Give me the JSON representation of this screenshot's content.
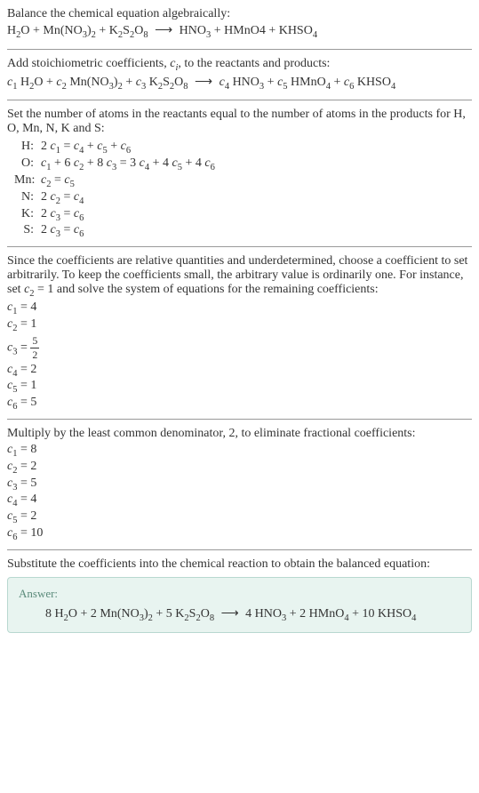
{
  "intro": {
    "line1": "Balance the chemical equation algebraically:",
    "eq": "H₂O + Mn(NO₃)₂ + K₂S₂O₈  ⟶  HNO₃ + HMnO4 + KHSO₄"
  },
  "stoich": {
    "line1": "Add stoichiometric coefficients, cᵢ, to the reactants and products:",
    "eq": "c₁ H₂O + c₂ Mn(NO₃)₂ + c₃ K₂S₂O₈  ⟶  c₄ HNO₃ + c₅ HMnO₄ + c₆ KHSO₄"
  },
  "atoms": {
    "intro": "Set the number of atoms in the reactants equal to the number of atoms in the products for H, O, Mn, N, K and S:",
    "rows": [
      {
        "el": "H:",
        "eq": "2 c₁ = c₄ + c₅ + c₆"
      },
      {
        "el": "O:",
        "eq": "c₁ + 6 c₂ + 8 c₃ = 3 c₄ + 4 c₅ + 4 c₆"
      },
      {
        "el": "Mn:",
        "eq": "c₂ = c₅"
      },
      {
        "el": "N:",
        "eq": "2 c₂ = c₄"
      },
      {
        "el": "K:",
        "eq": "2 c₃ = c₆"
      },
      {
        "el": "S:",
        "eq": "2 c₃ = c₆"
      }
    ]
  },
  "solve1": {
    "intro": "Since the coefficients are relative quantities and underdetermined, choose a coefficient to set arbitrarily. To keep the coefficients small, the arbitrary value is ordinarily one. For instance, set c₂ = 1 and solve the system of equations for the remaining coefficients:",
    "rows": [
      {
        "lhs": "c₁",
        "rhs": "4",
        "frac": false
      },
      {
        "lhs": "c₂",
        "rhs": "1",
        "frac": false
      },
      {
        "lhs": "c₃",
        "num": "5",
        "den": "2",
        "frac": true
      },
      {
        "lhs": "c₄",
        "rhs": "2",
        "frac": false
      },
      {
        "lhs": "c₅",
        "rhs": "1",
        "frac": false
      },
      {
        "lhs": "c₆",
        "rhs": "5",
        "frac": false
      }
    ]
  },
  "solve2": {
    "intro": "Multiply by the least common denominator, 2, to eliminate fractional coefficients:",
    "rows": [
      {
        "lhs": "c₁",
        "rhs": "8"
      },
      {
        "lhs": "c₂",
        "rhs": "2"
      },
      {
        "lhs": "c₃",
        "rhs": "5"
      },
      {
        "lhs": "c₄",
        "rhs": "4"
      },
      {
        "lhs": "c₅",
        "rhs": "2"
      },
      {
        "lhs": "c₆",
        "rhs": "10"
      }
    ]
  },
  "final": {
    "intro": "Substitute the coefficients into the chemical reaction to obtain the balanced equation:",
    "answer_label": "Answer:",
    "answer_eq": "8 H₂O + 2 Mn(NO₃)₂ + 5 K₂S₂O₈  ⟶  4 HNO₃ + 2 HMnO₄ + 10 KHSO₄"
  }
}
